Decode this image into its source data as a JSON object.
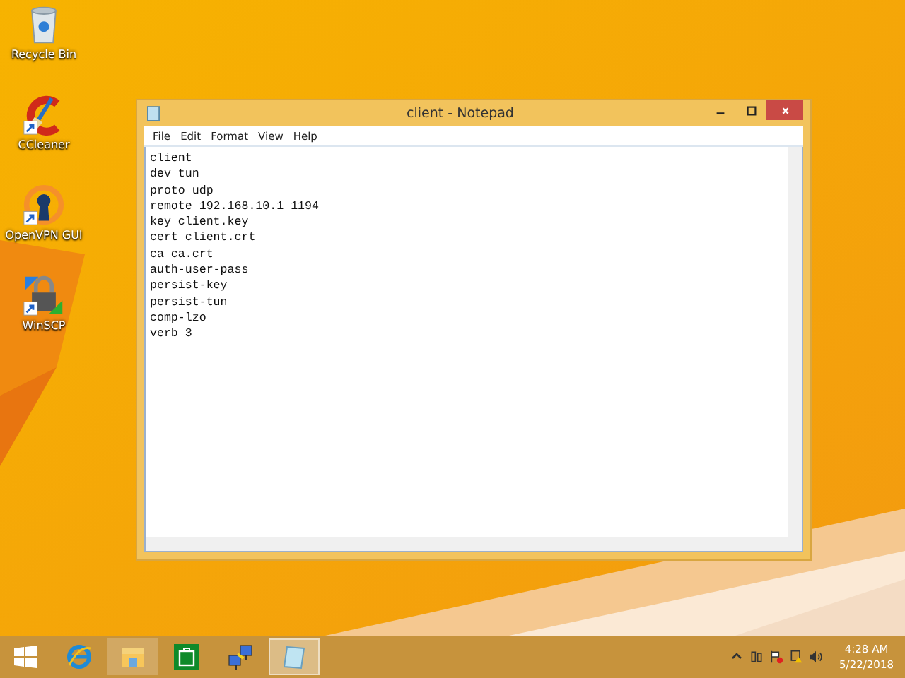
{
  "desktop_icons": [
    {
      "label": "Recycle Bin",
      "kind": "recycle",
      "shortcut": false
    },
    {
      "label": "CCleaner",
      "kind": "ccleaner",
      "shortcut": true
    },
    {
      "label": "OpenVPN GUI",
      "kind": "openvpn",
      "shortcut": true
    },
    {
      "label": "WinSCP",
      "kind": "winscp",
      "shortcut": true
    }
  ],
  "window": {
    "title": "client - Notepad",
    "menu": [
      "File",
      "Edit",
      "Format",
      "View",
      "Help"
    ],
    "lines": [
      "client",
      "dev tun",
      "proto udp",
      "remote 192.168.10.1 1194",
      "key client.key",
      "cert client.crt",
      "ca ca.crt",
      "auth-user-pass",
      "persist-key",
      "persist-tun",
      "comp-lzo",
      "verb 3"
    ]
  },
  "taskbar": {
    "items": [
      {
        "kind": "start",
        "running": false,
        "selected": false
      },
      {
        "kind": "ie",
        "running": false,
        "selected": false
      },
      {
        "kind": "explorer",
        "running": true,
        "selected": false
      },
      {
        "kind": "store",
        "running": false,
        "selected": false
      },
      {
        "kind": "network",
        "running": false,
        "selected": false
      },
      {
        "kind": "notepad",
        "running": true,
        "selected": true
      }
    ],
    "time": "4:28 AM",
    "date": "5/22/2018"
  }
}
